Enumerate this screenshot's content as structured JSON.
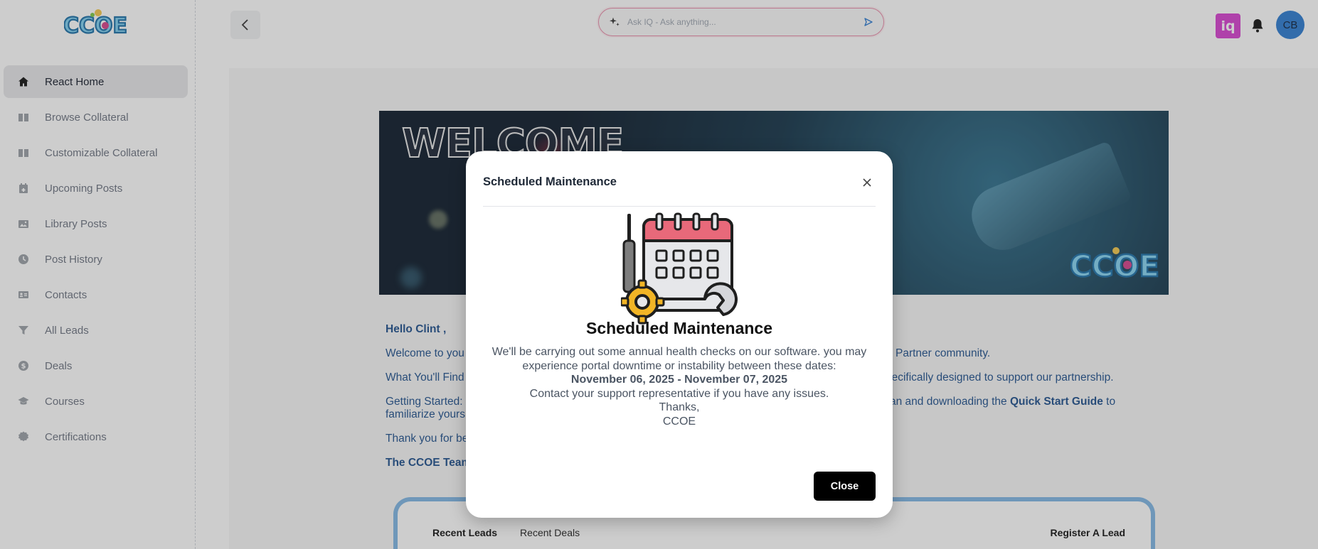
{
  "brand": {
    "logo_text": "CCOE"
  },
  "sidebar": {
    "items": [
      {
        "label": "React Home",
        "icon": "home-icon",
        "active": true
      },
      {
        "label": "Browse Collateral",
        "icon": "book-icon"
      },
      {
        "label": "Customizable Collateral",
        "icon": "book-icon"
      },
      {
        "label": "Upcoming Posts",
        "icon": "calendar-icon"
      },
      {
        "label": "Library Posts",
        "icon": "image-icon"
      },
      {
        "label": "Post History",
        "icon": "clock-icon"
      },
      {
        "label": "Contacts",
        "icon": "contact-card-icon"
      },
      {
        "label": "All Leads",
        "icon": "filter-icon"
      },
      {
        "label": "Deals",
        "icon": "dollar-icon"
      },
      {
        "label": "Courses",
        "icon": "graduation-cap-icon"
      },
      {
        "label": "Certifications",
        "icon": "certificate-icon"
      }
    ]
  },
  "topbar": {
    "search_placeholder": "Ask IQ - Ask anything...",
    "iq_label": "iq",
    "avatar_initials": "CB"
  },
  "banner": {
    "welcome_text": "WELCOME",
    "logo_text": "CCOE"
  },
  "welcome": {
    "greeting": "Hello Clint ,",
    "line1_start": "Welcome to you",
    "line1_end": "Partner community.",
    "line2_start": "What You'll Find",
    "line2_end": "pecifically designed to support our partnership.",
    "line3_start": "Getting Started:",
    "line3_mid": "an and downloading the",
    "line3_link": "Quick Start Guide",
    "line3_end": "to",
    "line3_cont": "familiarize yours",
    "line4": "Thank you for be",
    "signoff": "The CCOE Team"
  },
  "card": {
    "tabs": [
      "Recent Leads",
      "Recent Deals"
    ],
    "action": "Register A Lead"
  },
  "modal": {
    "title": "Scheduled Maintenance",
    "heading": "Scheduled Maintenance",
    "body_line1": "We'll be carrying out some annual health checks on our software. you may",
    "body_line2": "experience portal downtime or instability between these dates:",
    "dates": "November 06, 2025 - November 07, 2025",
    "body_line3": "Contact your support representative if you have any issues.",
    "thanks": "Thanks,",
    "sender": "CCOE",
    "close_label": "Close"
  },
  "colors": {
    "accent_pink": "#e88aa8",
    "iq_magenta": "#d63fd0",
    "avatar_blue": "#2b7bd1",
    "link_blue": "#1d4f8c",
    "card_border": "#7eb6e4"
  }
}
